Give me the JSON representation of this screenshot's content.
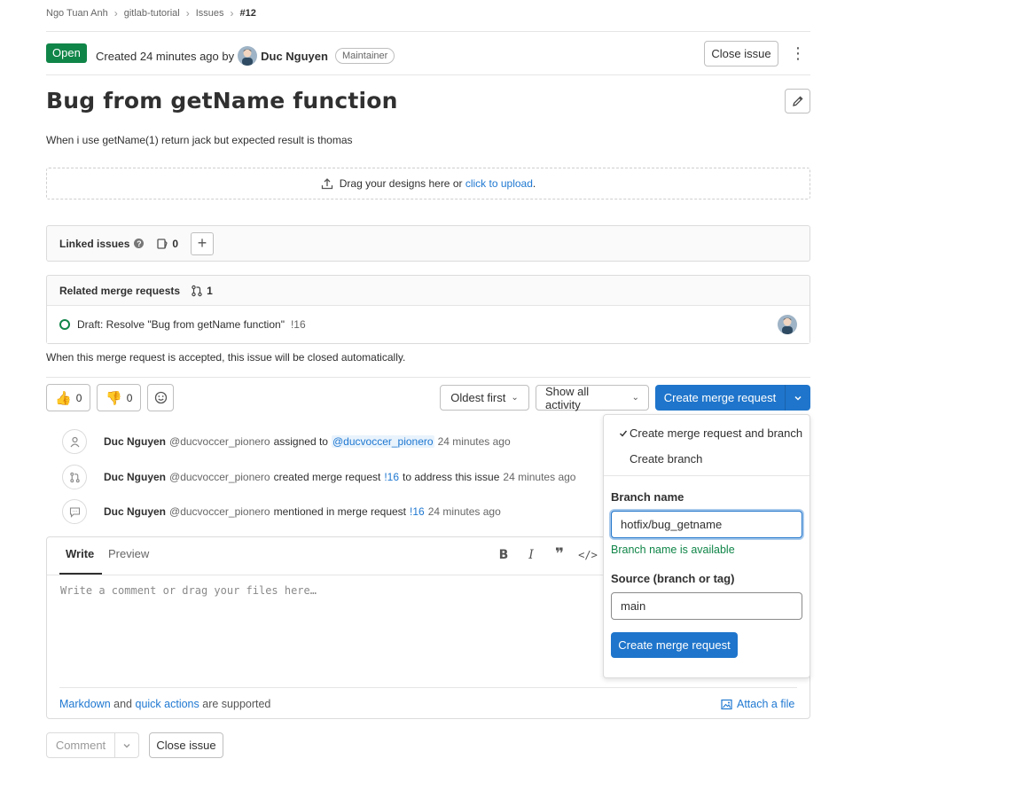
{
  "breadcrumb": [
    "Ngo Tuan Anh",
    "gitlab-tutorial",
    "Issues",
    "#12"
  ],
  "issue": {
    "status": "Open",
    "created_prefix": "Created 24 minutes ago by",
    "author": "Duc Nguyen",
    "role": "Maintainer",
    "close_label": "Close issue",
    "title": "Bug from getName function",
    "description": "When i use getName(1) return jack but expected result is thomas"
  },
  "upload": {
    "text": "Drag your designs here or",
    "link": "click to upload",
    "suffix": "."
  },
  "linked_issues": {
    "label": "Linked issues",
    "count": "0"
  },
  "related_mrs": {
    "label": "Related merge requests",
    "count": "1",
    "item_title": "Draft: Resolve \"Bug from getName function\"",
    "item_ref": "!16",
    "auto_close": "When this merge request is accepted, this issue will be closed automatically."
  },
  "awards": {
    "thumbs_up": "0",
    "thumbs_down": "0"
  },
  "filters": {
    "sort": "Oldest first",
    "activity": "Show all activity"
  },
  "create_mr": "Create merge request",
  "timeline": [
    {
      "name": "Duc Nguyen",
      "handle": "@ducvoccer_pionero",
      "action": "assigned to",
      "target": "@ducvoccer_pionero",
      "after": "",
      "time": "24 minutes ago"
    },
    {
      "name": "Duc Nguyen",
      "handle": "@ducvoccer_pionero",
      "action": "created merge request",
      "target": "!16",
      "after": "to address this issue",
      "time": "24 minutes ago"
    },
    {
      "name": "Duc Nguyen",
      "handle": "@ducvoccer_pionero",
      "action": "mentioned in merge request",
      "target": "!16",
      "after": "",
      "time": "24 minutes ago"
    }
  ],
  "comment": {
    "tab_write": "Write",
    "tab_preview": "Preview",
    "placeholder": "Write a comment or drag your files here…",
    "markdown": "Markdown",
    "and": "and",
    "quick_actions": "quick actions",
    "supported": "are supported",
    "attach": "Attach a file",
    "submit": "Comment",
    "close": "Close issue"
  },
  "dropdown": {
    "option1": "Create merge request and branch",
    "option2": "Create branch",
    "branch_label": "Branch name",
    "branch_value": "hotfix/bug_getname",
    "branch_status": "Branch name is available",
    "source_label": "Source (branch or tag)",
    "source_value": "main",
    "submit": "Create merge request"
  },
  "colors": {
    "open": "#108548",
    "primary": "#1f75cb",
    "link": "#1f78d1"
  }
}
